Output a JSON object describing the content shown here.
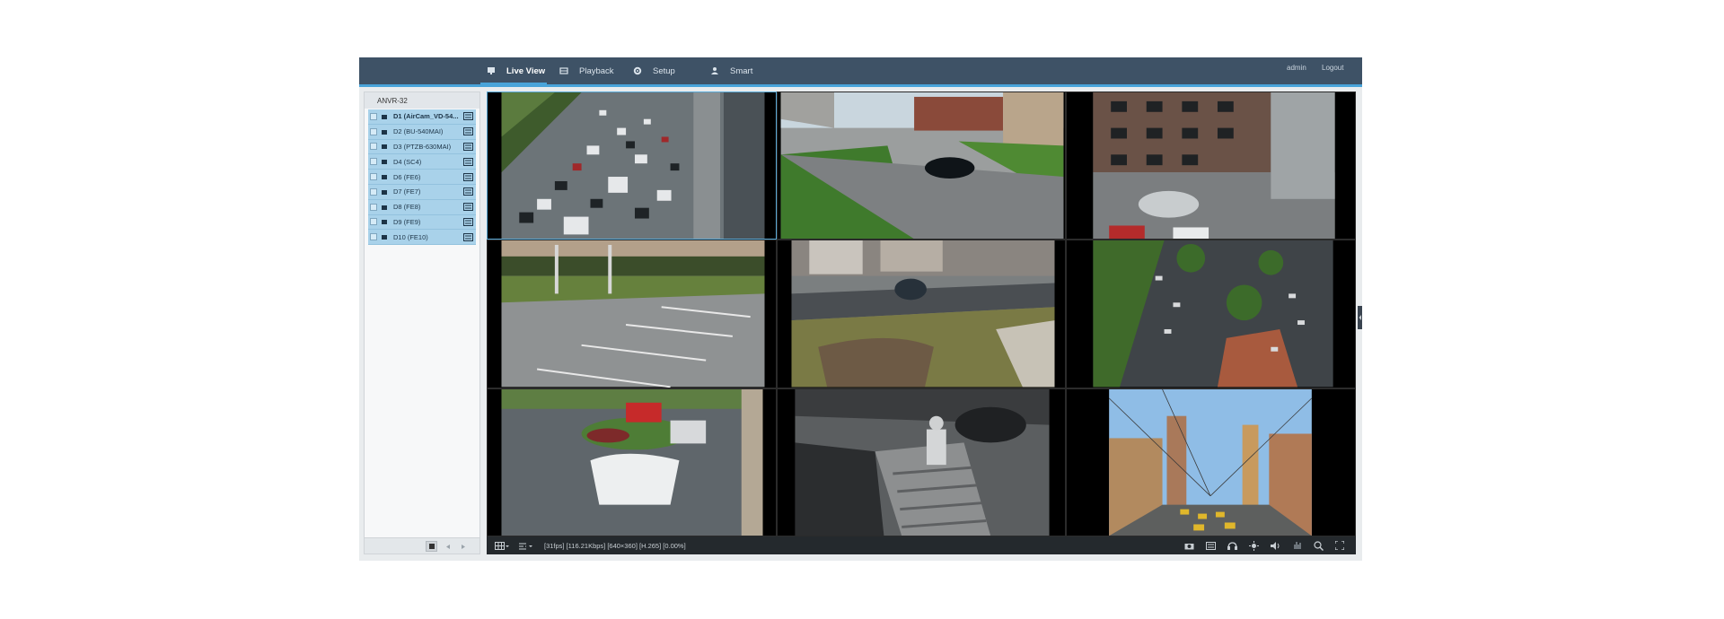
{
  "nav": {
    "live_view": "Live View",
    "playback": "Playback",
    "setup": "Setup",
    "smart": "Smart",
    "user": "admin",
    "logout": "Logout"
  },
  "sidebar": {
    "root": "ANVR-32",
    "devices": [
      {
        "label": "D1 (AirCam_VD-54..."
      },
      {
        "label": "D2 (BU-540MAI)"
      },
      {
        "label": "D3 (PTZB-630MAI)"
      },
      {
        "label": "D4 (SC4)"
      },
      {
        "label": "D6 (FE6)"
      },
      {
        "label": "D7 (FE7)"
      },
      {
        "label": "D8 (FE8)"
      },
      {
        "label": "D9 (FE9)"
      },
      {
        "label": "D10 (FE10)"
      }
    ]
  },
  "toolbar": {
    "status": "[31fps] [116.21Kbps] [640×360] [H.265] [0.00%]"
  },
  "cameras": [
    {
      "icon": "highway-traffic-feed"
    },
    {
      "icon": "residential-street-feed"
    },
    {
      "icon": "courtyard-overhead-feed"
    },
    {
      "icon": "parking-lot-feed"
    },
    {
      "icon": "house-front-yard-feed"
    },
    {
      "icon": "aerial-parking-feed"
    },
    {
      "icon": "driveway-cars-feed"
    },
    {
      "icon": "night-stairs-feed"
    },
    {
      "icon": "city-street-feed"
    }
  ],
  "colors": {
    "header": "#3e5266",
    "accent": "#49a4d9",
    "device_row": "#a9d2ea",
    "toolbar": "#24292d"
  }
}
